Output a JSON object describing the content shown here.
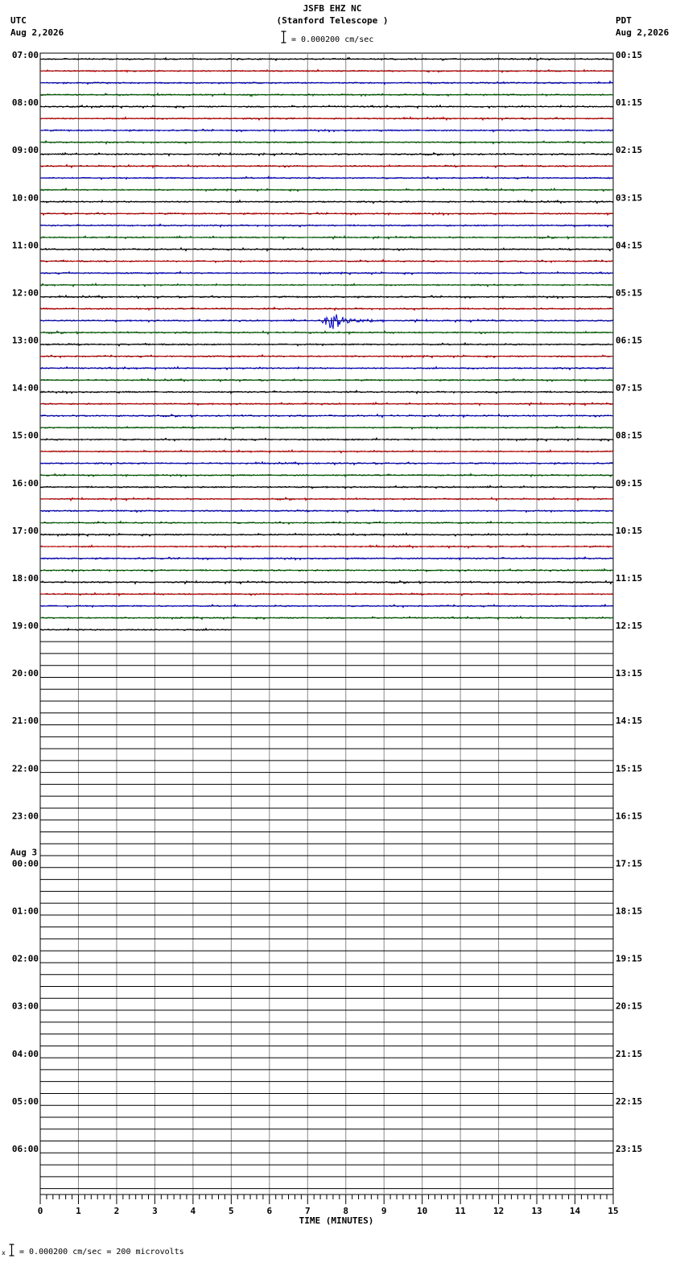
{
  "header": {
    "title": "JSFB EHZ NC",
    "subtitle": "(Stanford Telescope )",
    "scale_text": "= 0.000200 cm/sec",
    "left_tz": "UTC",
    "left_date": "Aug 2,2026",
    "right_tz": "PDT",
    "right_date": "Aug 2,2026"
  },
  "footer": {
    "scale_note": "= 0.000200 cm/sec =     200 microvolts",
    "marker": "x"
  },
  "chart_data": {
    "type": "line",
    "title": "JSFB EHZ NC",
    "xlabel": "TIME (MINUTES)",
    "xlim": [
      0,
      15
    ],
    "x_ticks": [
      "0",
      "1",
      "2",
      "3",
      "4",
      "5",
      "6",
      "7",
      "8",
      "9",
      "10",
      "11",
      "12",
      "13",
      "14",
      "15"
    ],
    "lines_per_hour": 4,
    "trace_colors": [
      "#000000",
      "#cc0000",
      "#0000cc",
      "#006600"
    ],
    "utc_labels": [
      "07:00",
      "08:00",
      "09:00",
      "10:00",
      "11:00",
      "12:00",
      "13:00",
      "14:00",
      "15:00",
      "16:00",
      "17:00",
      "18:00",
      "19:00",
      "20:00",
      "21:00",
      "22:00",
      "23:00",
      "00:00",
      "01:00",
      "02:00",
      "03:00",
      "04:00",
      "05:00",
      "06:00"
    ],
    "date_change_label": "Aug 3",
    "date_change_hour_index": 17,
    "pdt_labels": [
      "00:15",
      "01:15",
      "02:15",
      "03:15",
      "04:15",
      "05:15",
      "06:15",
      "07:15",
      "08:15",
      "09:15",
      "10:15",
      "11:15",
      "12:15",
      "13:15",
      "14:15",
      "15:15",
      "16:15",
      "17:15",
      "18:15",
      "19:15",
      "20:15",
      "21:15",
      "22:15",
      "23:15"
    ],
    "recorded_lines": 49,
    "last_line_end_minute": 5,
    "event": {
      "line_index": 22,
      "start_minute": 7.3,
      "peak_minute": 7.7,
      "end_minute": 9.0
    }
  }
}
